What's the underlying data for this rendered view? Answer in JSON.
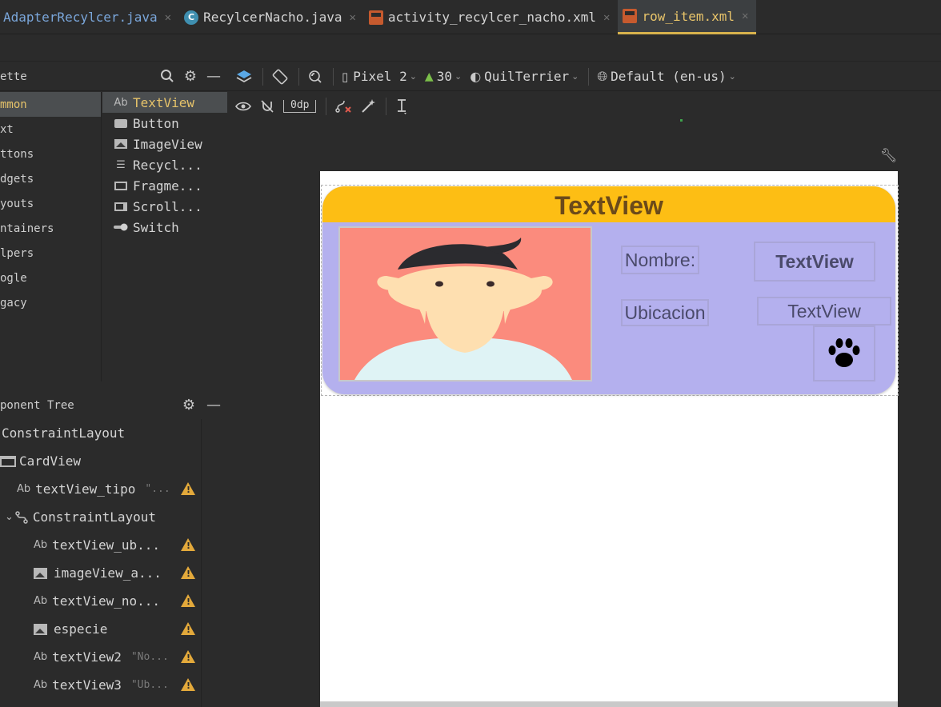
{
  "tabs": [
    {
      "label": "AdapterRecylcer.java",
      "icon": "java-file-icon"
    },
    {
      "label": "RecylcerNacho.java",
      "icon": "class-icon"
    },
    {
      "label": "activity_recylcer_nacho.xml",
      "icon": "xml-layout-icon"
    },
    {
      "label": "row_item.xml",
      "icon": "xml-layout-icon",
      "active": true
    }
  ],
  "palette": {
    "title": "ette",
    "categories": [
      "mmon",
      "xt",
      "ttons",
      "dgets",
      "youts",
      "ntainers",
      "lpers",
      "ogle",
      "gacy"
    ],
    "selected_category": "mmon",
    "items": [
      {
        "icon": "Ab",
        "label": "TextView"
      },
      {
        "icon": "button-icon",
        "label": "Button"
      },
      {
        "icon": "image-icon",
        "label": "ImageView"
      },
      {
        "icon": "list-icon",
        "label": "Recycl..."
      },
      {
        "icon": "fragment-icon",
        "label": "Fragme..."
      },
      {
        "icon": "scroll-icon",
        "label": "Scroll..."
      },
      {
        "icon": "switch-icon",
        "label": "Switch"
      }
    ],
    "selected_item": "TextView"
  },
  "component_tree": {
    "title": "ponent Tree",
    "rows": [
      {
        "label": "ConstraintLayout",
        "hint": "",
        "warning": false
      },
      {
        "label": "CardView",
        "hint": "",
        "warning": false
      },
      {
        "label": "textView_tipo",
        "hint": "\"...",
        "warning": true
      },
      {
        "label": "ConstraintLayout",
        "hint": "",
        "warning": false
      },
      {
        "label": "textView_ub...",
        "hint": "",
        "warning": true
      },
      {
        "label": "imageView_a...",
        "hint": "",
        "warning": true
      },
      {
        "label": "textView_no...",
        "hint": "",
        "warning": true
      },
      {
        "label": "especie",
        "hint": "",
        "warning": true
      },
      {
        "label": "textView2",
        "hint": "\"No...",
        "warning": true
      },
      {
        "label": "textView3",
        "hint": "\"Ub...",
        "warning": true
      }
    ]
  },
  "toolbar": {
    "device": "Pixel 2",
    "api": "30",
    "theme": "QuilTerrier",
    "locale": "Default (en-us)",
    "margin": "0dp"
  },
  "card": {
    "title": "TextView",
    "label_name": "Nombre:",
    "value_name": "TextView",
    "label_location": "Ubicacion",
    "value_location": "TextView",
    "header_color": "#fdbe14",
    "body_color": "#b4b0ee",
    "avatar_bg": "#fb8b7d"
  },
  "colors": {
    "ide_bg": "#2b2b2b",
    "accent_tab": "#d8b24c",
    "warning": "#e3a93b"
  }
}
